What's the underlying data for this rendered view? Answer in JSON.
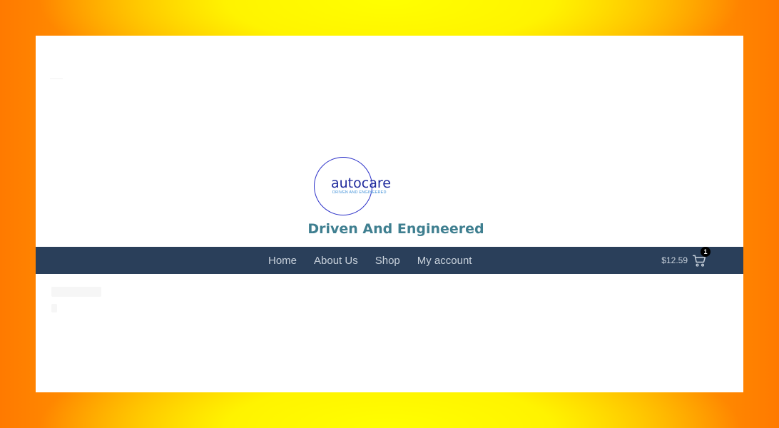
{
  "site": {
    "logo_word": "autocare",
    "logo_tagline": "DRIVEN AND ENGINEERED",
    "tagline": "Driven And Engineered"
  },
  "nav": {
    "items": [
      {
        "label": "Home"
      },
      {
        "label": "About Us"
      },
      {
        "label": "Shop"
      },
      {
        "label": "My account"
      }
    ]
  },
  "cart": {
    "total": "$12.59",
    "count": "1",
    "icon": "cart-icon"
  },
  "colors": {
    "navbar": "#2a3f5a",
    "tagline": "#3f7f90",
    "logo": "#1f2a9c",
    "frame_outer": "#ff7a00",
    "frame_inner": "#ffff00"
  }
}
